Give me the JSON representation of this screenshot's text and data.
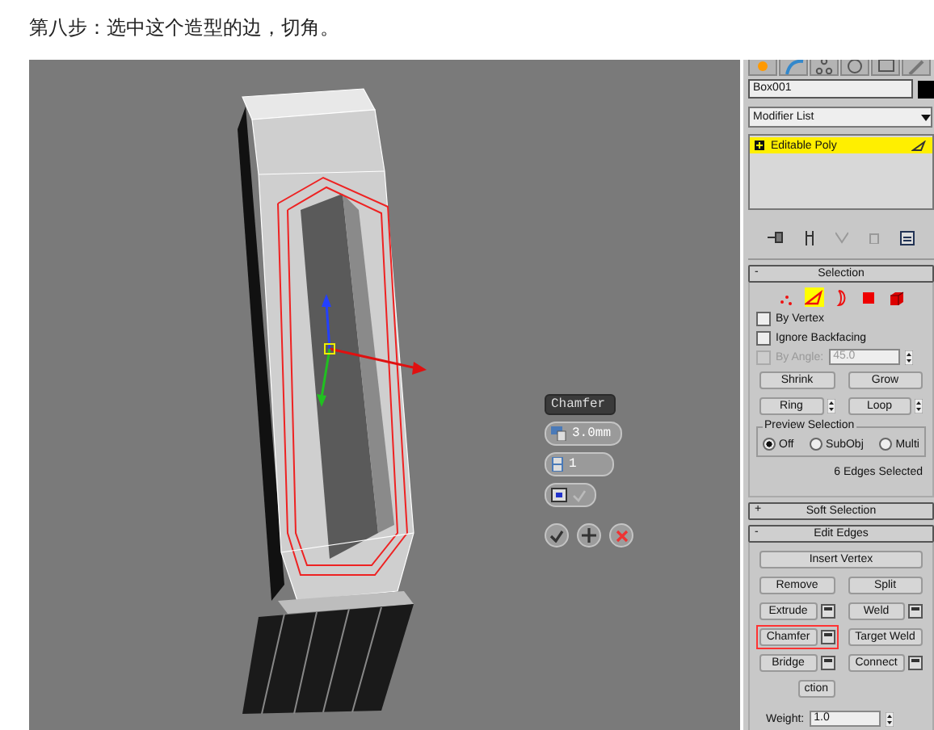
{
  "caption": "第八步：选中这个造型的边，切角。",
  "viewport": {
    "caddy": {
      "title": "Chamfer",
      "amount": "3.0mm",
      "segments": "1",
      "toggle_checked": false
    }
  },
  "command_panel": {
    "object_name": "Box001",
    "modifier_list": "Modifier List",
    "stack": [
      {
        "label": "Editable Poly",
        "selected": true
      }
    ],
    "selection": {
      "sign": "-",
      "title": "Selection",
      "levels": [
        {
          "kind": "vertex",
          "selected": false
        },
        {
          "kind": "edge",
          "selected": true
        },
        {
          "kind": "border",
          "selected": false
        },
        {
          "kind": "polygon",
          "selected": false
        },
        {
          "kind": "element",
          "selected": false
        }
      ],
      "checkboxes": [
        {
          "label": "By Vertex",
          "checked": false,
          "disabled": false
        },
        {
          "label": "Ignore Backfacing",
          "checked": false,
          "disabled": false
        },
        {
          "label": "By Angle:",
          "checked": false,
          "disabled": true
        }
      ],
      "angle": "45.0",
      "buttons": [
        {
          "label": "Shrink",
          "kind": "plain"
        },
        {
          "label": "Grow",
          "kind": "plain"
        },
        {
          "label": "Ring",
          "kind": "spinner"
        },
        {
          "label": "Loop",
          "kind": "spinner"
        }
      ],
      "preview": {
        "title": "Preview Selection",
        "options": [
          {
            "label": "Off",
            "selected": true
          },
          {
            "label": "SubObj",
            "selected": false
          },
          {
            "label": "Multi",
            "selected": false
          }
        ]
      },
      "status": "6 Edges Selected"
    },
    "soft_selection": {
      "sign": "+",
      "title": "Soft Selection"
    },
    "edit_edges": {
      "sign": "-",
      "title": "Edit Edges",
      "buttons": [
        {
          "label": "Insert Vertex",
          "kind": "wide",
          "highlighted": false
        },
        {
          "label": "Remove",
          "kind": "plain",
          "highlighted": false
        },
        {
          "label": "Split",
          "kind": "plain",
          "highlighted": false
        },
        {
          "label": "Extrude",
          "kind": "settings",
          "highlighted": false
        },
        {
          "label": "Weld",
          "kind": "settings",
          "highlighted": false
        },
        {
          "label": "Chamfer",
          "kind": "settings",
          "highlighted": true
        },
        {
          "label": "Target Weld",
          "kind": "plain",
          "highlighted": false
        },
        {
          "label": "Bridge",
          "kind": "settings",
          "highlighted": false
        },
        {
          "label": "Connect",
          "kind": "settings",
          "highlighted": false
        },
        {
          "label": "ction",
          "kind": "cut",
          "highlighted": false
        }
      ],
      "weight_label": "Weight:",
      "weight": "1.0"
    }
  }
}
